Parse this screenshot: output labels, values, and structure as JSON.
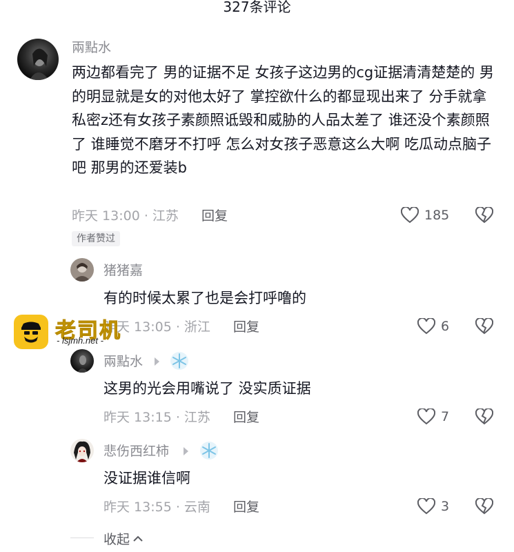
{
  "header": {
    "title": "327条评论"
  },
  "comments": [
    {
      "author": "兩點水",
      "text": "两边都看完了 男的证据不足 女孩子这边男的cg证据清清楚楚的 男的明显就是女的对他太好了 掌控欲什么的都显现出来了 分手就拿私密z还有女孩子素颜照诋毁和威胁的人品太差了 谁还没个素颜照了 谁睡觉不磨牙不打呼 怎么对女孩子恶意这么大啊 吃瓜动点脑子吧 那男的还爱装b",
      "time": "昨天 13:00 · 江苏",
      "reply_label": "回复",
      "likes": "185",
      "badge": "作者赞过",
      "avatar_icon": "dark-portrait-icon"
    }
  ],
  "replies": [
    {
      "author": "猪猪嘉",
      "text": "有的时候太累了也是会打呼噜的",
      "time": "昨天 13:05 · 浙江",
      "reply_label": "回复",
      "likes": "6",
      "avatar_icon": "portrait-icon"
    },
    {
      "author": "兩點水",
      "reply_arrow_icon": "reply-arrow-icon",
      "reply_to_icon": "snowflake-icon",
      "text": "这男的光会用嘴说了 没实质证据",
      "time": "昨天 13:15 · 江苏",
      "reply_label": "回复",
      "likes": "7",
      "avatar_icon": "dark-portrait-icon"
    },
    {
      "author": "悲伤西红柿",
      "reply_arrow_icon": "reply-arrow-icon",
      "reply_to_icon": "snowflake-icon",
      "text": "没证据谁信啊",
      "time": "昨天 13:55 · 云南",
      "reply_label": "回复",
      "likes": "3",
      "avatar_icon": "anime-portrait-icon"
    }
  ],
  "collapse": {
    "label": "收起"
  },
  "watermark": {
    "brand": "老司机",
    "url": "- lsjmh.net -"
  },
  "colors": {
    "brand": "#f7c21c",
    "muted": "#a3a4a9",
    "text": "#161823"
  }
}
